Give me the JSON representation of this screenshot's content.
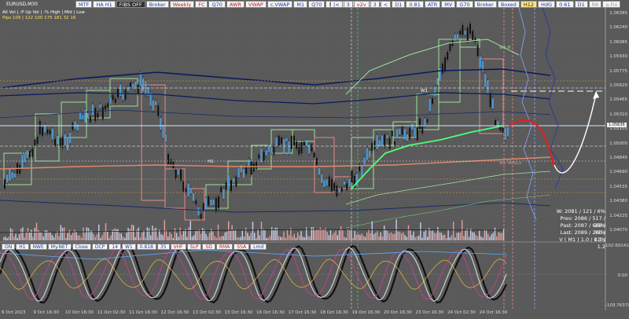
{
  "symbol": "EURUSD,M30",
  "toolbar_left": [
    "MTF",
    "HA H1",
    "FIBS OFF",
    "Broker",
    "Weekly",
    "FC",
    "Q70",
    "AWR",
    "VWAP",
    "c.VWAP",
    "M1",
    "Q70",
    "MV",
    "ATR",
    "0.61",
    "D1"
  ],
  "toolbar_right": [
    "|<",
    "3",
    "v2v",
    "3",
    "<",
    "D1",
    "0.81",
    "ATR",
    "MV",
    "G70",
    "Broker",
    "Boxed",
    "H12",
    "HdG",
    "0.61",
    "D1",
    "RA",
    "a.Fix"
  ],
  "legend": {
    "header": "All   Vol  | -P   Up    Vol  | -%   High | Mid | Low",
    "row1": "Pips  109 | 122   100   175    181   32   16"
  },
  "tags": {
    "w1": "W1",
    "wk_h": "Wk H",
    "h1": "H1",
    "wk_mid": "Wk Mid/Lo",
    "price_box": "1.05636"
  },
  "stats": [
    "W: 2081 / 121 / 6%",
    "Prev: 2086 / 517 / 25%",
    "Past: 2087 / 688 / 33%",
    "Last: 2089 / 240 / 11%",
    "V ( M1 )  1.0 / 0.1 / 1.2"
  ],
  "indicator_buttons": [
    "ON",
    "H1",
    "NWE",
    "My.NET",
    "Close",
    "DCP",
    "14",
    "W1",
    "0.818",
    "35",
    "VHF",
    "SLP",
    "SD",
    "RMA",
    "SSA",
    "Lmd"
  ],
  "indicator_scale": {
    "top": "102.60141",
    "zero": "0.00",
    "bottom": "-103.76379"
  },
  "price_ticks": [
    "1.06395",
    "1.06240",
    "1.06085",
    "1.05930",
    "1.05775",
    "1.05620",
    "1.05465",
    "1.05310",
    "1.05155",
    "1.05000",
    "1.04845",
    "1.04690",
    "1.04535",
    "1.04380",
    "1.04225",
    "1.04070"
  ],
  "time_ticks": [
    "6 Oct 2023",
    "9 Oct 16:30",
    "10 Oct 16:30",
    "11 Oct 02:30",
    "11 Oct 16:30",
    "12 Oct 16:30",
    "13 Oct 02:30",
    "13 Oct 16:30",
    "16 Oct 16:30",
    "17 Oct 16:30",
    "18 Oct 16:30",
    "19 Oct 16:30",
    "20 Oct 16:30",
    "23 Oct 16:30",
    "24 Oct 02:30",
    "24 Oct 16:30"
  ],
  "colors": {
    "bg": "#5a5a5a",
    "bull": "#9be39b",
    "bear": "#e58a8a",
    "vwap": "#4cff7a",
    "ma_dark": "#0a1a5a",
    "ma_salmon": "#e08a6a",
    "forecast_red": "#e02020",
    "forecast_white": "#ffffff"
  }
}
